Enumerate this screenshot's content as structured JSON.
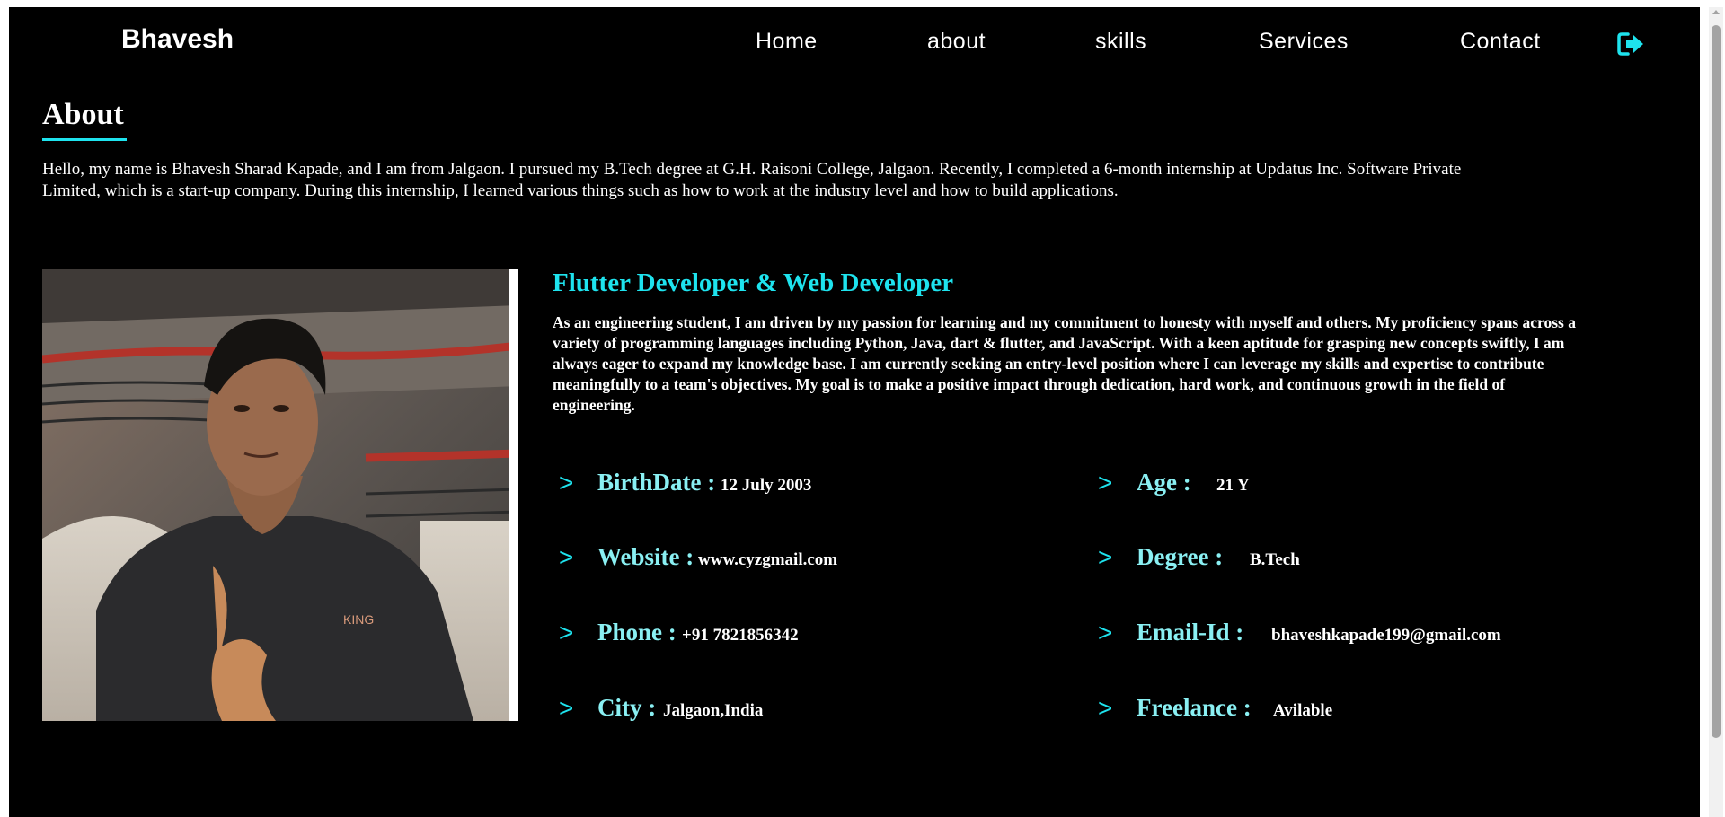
{
  "header": {
    "brand": "Bhavesh",
    "nav": [
      "Home",
      "about",
      "skills",
      "Services",
      "Contact"
    ],
    "logout_icon": "sign-out-icon"
  },
  "about": {
    "title": "About",
    "intro": "Hello, my name is Bhavesh Sharad Kapade, and I am from Jalgaon. I pursued my B.Tech degree at G.H. Raisoni College, Jalgaon. Recently, I completed a 6-month internship at Updatus Inc. Software Private Limited, which is a start-up company. During this internship, I learned various things such as how to work at the industry level and how to build applications.",
    "role": "Flutter Developer & Web Developer",
    "description": "As an engineering student, I am driven by my passion for learning and my commitment to honesty with myself and others. My proficiency spans across a variety of programming languages including Python, Java, dart & flutter, and JavaScript. With a keen aptitude for grasping new concepts swiftly, I am always eager to expand my knowledge base. I am currently seeking an entry-level position where I can leverage my skills and expertise to contribute meaningfully to a team's objectives. My goal is to make a positive impact through dedication, hard work, and continuous growth in the field of engineering.",
    "details": [
      {
        "label": "BirthDate :",
        "value": "12 July 2003"
      },
      {
        "label": "Age :",
        "value": "21 Y"
      },
      {
        "label": "Website :",
        "value": "www.cyzgmail.com"
      },
      {
        "label": "Degree :",
        "value": "B.Tech"
      },
      {
        "label": "Phone :",
        "value": "+91 7821856342"
      },
      {
        "label": "Email-Id :",
        "value": "bhaveshkapade199@gmail.com"
      },
      {
        "label": "City :",
        "value": "Jalgaon,India"
      },
      {
        "label": "Freelance :",
        "value": "Avilable"
      }
    ],
    "chevron": ">"
  },
  "colors": {
    "accent": "#1ee3ee",
    "label": "#8af0f3",
    "background": "#000000",
    "text": "#ffffff"
  }
}
